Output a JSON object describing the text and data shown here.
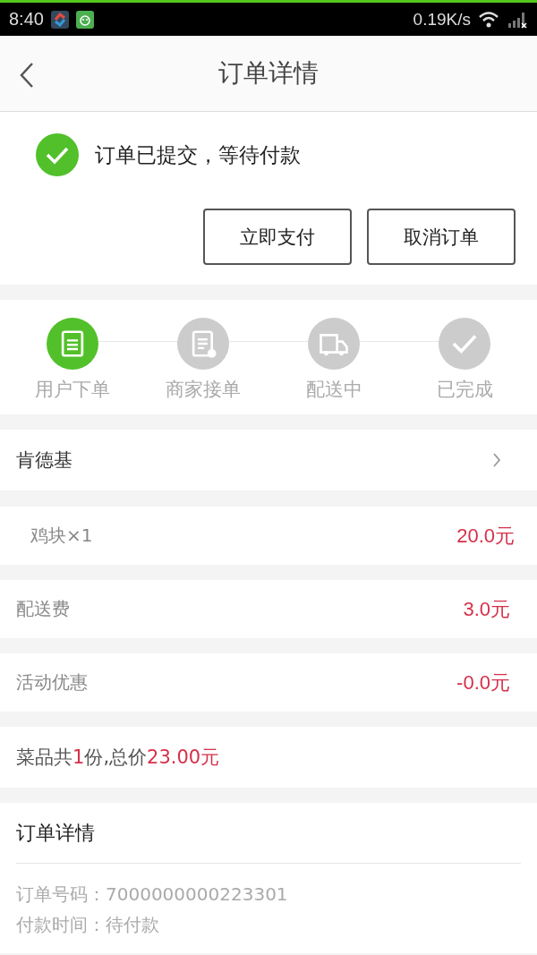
{
  "status_bar": {
    "time": "8:40",
    "speed": "0.19K/s"
  },
  "header": {
    "title": "订单详情"
  },
  "order_status": {
    "message": "订单已提交，等待付款",
    "buttons": [
      "立即支付",
      "取消订单"
    ]
  },
  "steps": [
    {
      "label": "用户下单",
      "kind": "order",
      "done": true
    },
    {
      "label": "商家接单",
      "kind": "accept",
      "done": false
    },
    {
      "label": "配送中",
      "kind": "delivery",
      "done": false
    },
    {
      "label": "已完成",
      "kind": "complete",
      "done": false
    }
  ],
  "shop": {
    "name": "肯德基"
  },
  "rows": [
    {
      "kind": "item",
      "label": "鸡块×1",
      "amount": "20.0元"
    },
    {
      "kind": "fee",
      "label": "配送费",
      "amount": "3.0元"
    },
    {
      "kind": "fee",
      "label": "活动优惠",
      "amount": "-0.0元"
    }
  ],
  "summary": [
    {
      "text": "菜品共",
      "highlight": false
    },
    {
      "text": "1",
      "highlight": true
    },
    {
      "text": "份,总价",
      "highlight": false
    },
    {
      "text": "23.00元",
      "highlight": true
    }
  ],
  "details": {
    "title": "订单详情",
    "lines": [
      "订单号码：7000000000223301",
      "付款时间：待付款"
    ]
  }
}
